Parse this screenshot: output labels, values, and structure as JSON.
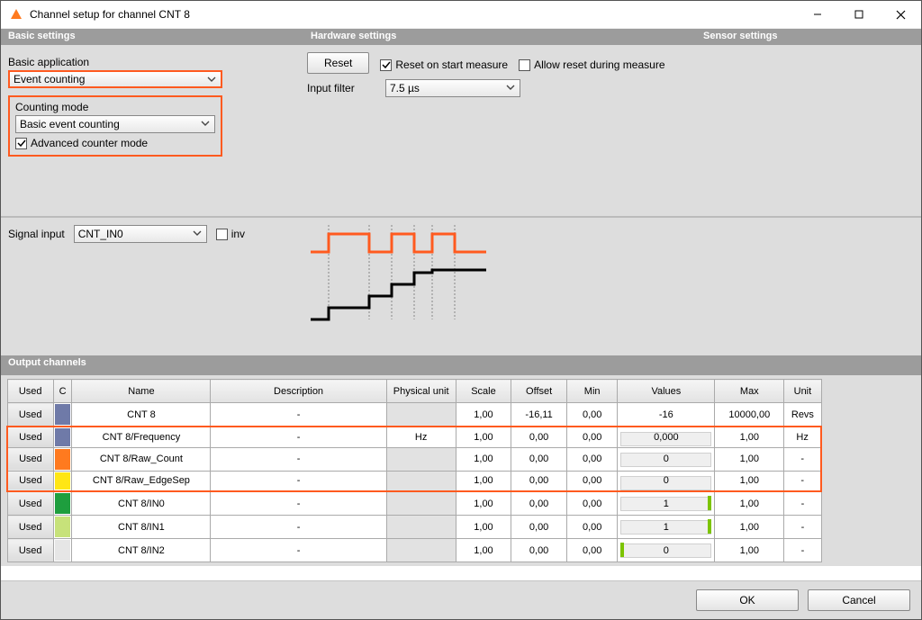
{
  "window": {
    "title": "Channel setup for channel CNT 8"
  },
  "sections": {
    "basic": "Basic settings",
    "hardware": "Hardware settings",
    "sensor": "Sensor settings"
  },
  "basic": {
    "app_label": "Basic application",
    "app_value": "Event counting",
    "mode_label": "Counting mode",
    "mode_value": "Basic event counting",
    "adv_label": "Advanced counter mode"
  },
  "hardware": {
    "reset_btn": "Reset",
    "reset_start": "Reset on start measure",
    "allow_reset": "Allow reset during measure",
    "filter_label": "Input filter",
    "filter_value": "7.5 µs"
  },
  "signal": {
    "label": "Signal input",
    "value": "CNT_IN0",
    "inv": "inv"
  },
  "output_header": "Output channels",
  "cols": {
    "used": "Used",
    "c": "C",
    "name": "Name",
    "desc": "Description",
    "phys": "Physical unit",
    "scale": "Scale",
    "offset": "Offset",
    "min": "Min",
    "values": "Values",
    "max": "Max",
    "unit": "Unit"
  },
  "rows": [
    {
      "used": "Used",
      "color": "#6f7aa8",
      "name": "CNT 8",
      "desc": "-",
      "phys": "",
      "phys_gray": true,
      "scale": "1,00",
      "offset": "-16,11",
      "min": "0,00",
      "val": "-16",
      "valstyle": "plain",
      "max": "10000,00",
      "unit": "Revs",
      "hl": false
    },
    {
      "used": "Used",
      "color": "#6f7aa8",
      "name": "CNT 8/Frequency",
      "desc": "-",
      "phys": "Hz",
      "phys_gray": false,
      "scale": "1,00",
      "offset": "0,00",
      "min": "0,00",
      "val": "0,000",
      "valstyle": "bar",
      "max": "1,00",
      "unit": "Hz",
      "hl": "top"
    },
    {
      "used": "Used",
      "color": "#ff7a1f",
      "name": "CNT 8/Raw_Count",
      "desc": "-",
      "phys": "",
      "phys_gray": true,
      "scale": "1,00",
      "offset": "0,00",
      "min": "0,00",
      "val": "0",
      "valstyle": "bar",
      "max": "1,00",
      "unit": "-",
      "hl": "mid"
    },
    {
      "used": "Used",
      "color": "#ffe615",
      "name": "CNT 8/Raw_EdgeSep",
      "desc": "-",
      "phys": "",
      "phys_gray": true,
      "scale": "1,00",
      "offset": "0,00",
      "min": "0,00",
      "val": "0",
      "valstyle": "bar",
      "max": "1,00",
      "unit": "-",
      "hl": "bot"
    },
    {
      "used": "Used",
      "color": "#1e9e3e",
      "name": "CNT 8/IN0",
      "desc": "-",
      "phys": "",
      "phys_gray": true,
      "scale": "1,00",
      "offset": "0,00",
      "min": "0,00",
      "val": "1",
      "valstyle": "green-right",
      "max": "1,00",
      "unit": "-",
      "hl": false
    },
    {
      "used": "Used",
      "color": "#c7e27a",
      "name": "CNT 8/IN1",
      "desc": "-",
      "phys": "",
      "phys_gray": true,
      "scale": "1,00",
      "offset": "0,00",
      "min": "0,00",
      "val": "1",
      "valstyle": "green-right",
      "max": "1,00",
      "unit": "-",
      "hl": false
    },
    {
      "used": "Used",
      "color": "#e6e6e6",
      "name": "CNT 8/IN2",
      "desc": "-",
      "phys": "",
      "phys_gray": true,
      "scale": "1,00",
      "offset": "0,00",
      "min": "0,00",
      "val": "0",
      "valstyle": "green-left",
      "max": "1,00",
      "unit": "-",
      "hl": false
    }
  ],
  "footer": {
    "ok": "OK",
    "cancel": "Cancel"
  }
}
